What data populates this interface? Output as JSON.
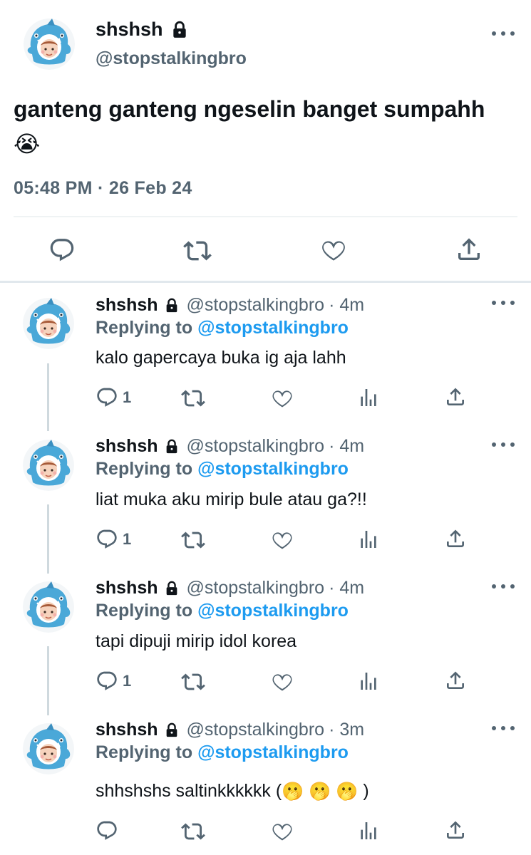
{
  "main_tweet": {
    "display_name": "shshsh",
    "handle": "@stopstalkingbro",
    "text": "ganteng ganteng ngeselin banget sumpahh",
    "emoji": "😭",
    "timestamp": "05:48 PM · 26 Feb 24"
  },
  "replies": [
    {
      "display_name": "shshsh",
      "handle": "@stopstalkingbro",
      "time": "· 4m",
      "replying_prefix": "Replying to",
      "replying_handle": "@stopstalkingbro",
      "text": "kalo gapercaya buka ig aja lahh",
      "reply_count": "1"
    },
    {
      "display_name": "shshsh",
      "handle": "@stopstalkingbro",
      "time": "· 4m",
      "replying_prefix": "Replying to",
      "replying_handle": "@stopstalkingbro",
      "text": "liat muka aku mirip bule atau ga?!!",
      "reply_count": "1"
    },
    {
      "display_name": "shshsh",
      "handle": "@stopstalkingbro",
      "time": "· 4m",
      "replying_prefix": "Replying to",
      "replying_handle": "@stopstalkingbro",
      "text": "tapi dipuji mirip idol korea",
      "reply_count": "1"
    },
    {
      "display_name": "shshsh",
      "handle": "@stopstalkingbro",
      "time": "· 3m",
      "replying_prefix": "Replying to",
      "replying_handle": "@stopstalkingbro",
      "text_before": "shhshshs saltinkkkkkk (",
      "text_emojis": "🫢 🫢 🫢",
      "text_after": " )",
      "reply_count": ""
    }
  ],
  "icons": {
    "reply": "speech-bubble-icon",
    "retweet": "retweet-icon",
    "like": "heart-icon",
    "analytics": "analytics-icon",
    "share": "share-icon",
    "lock": "lock-icon",
    "more": "more-dots-icon"
  },
  "colors": {
    "link": "#1d9bf0",
    "muted": "#536471",
    "text": "#0f1419",
    "avatar_shark": "#4aa8d8"
  }
}
